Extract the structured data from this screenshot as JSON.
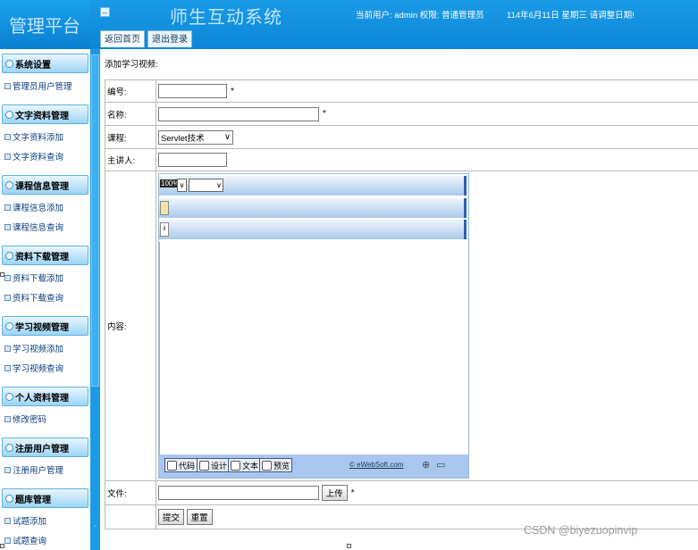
{
  "header": {
    "logo_text": "管理平台",
    "system_title": "师生互动系统",
    "user_info": "当前用户: admin 权限: 普通管理员",
    "date_info": "114年6月11日 星期三   请调整日期!",
    "toggle_icon": "◂▸",
    "tabs": [
      {
        "label": "返回首页"
      },
      {
        "label": "退出登录"
      }
    ]
  },
  "sidebar": {
    "groups": [
      {
        "title": "系统设置",
        "items": [
          "管理员用户管理"
        ]
      },
      {
        "title": "文字资料管理",
        "items": [
          "文字资料添加",
          "文字资料查询"
        ]
      },
      {
        "title": "课程信息管理",
        "items": [
          "课程信息添加",
          "课程信息查询"
        ]
      },
      {
        "title": "资料下载管理",
        "items": [
          "资料下载添加",
          "资料下载查询"
        ]
      },
      {
        "title": "学习视频管理",
        "items": [
          "学习视频添加",
          "学习视频查询"
        ]
      },
      {
        "title": "个人资料管理",
        "items": [
          "修改密码"
        ]
      },
      {
        "title": "注册用户管理",
        "items": [
          "注册用户管理"
        ]
      },
      {
        "title": "题库管理",
        "items": [
          "试题添加",
          "试题查询"
        ]
      }
    ]
  },
  "main": {
    "page_title": "添加学习视频:",
    "form": {
      "number_label": "编号:",
      "name_label": "名称:",
      "course_label": "课程:",
      "course_value": "Servlet技术",
      "speaker_label": "主讲人:",
      "content_label": "内容:",
      "file_label": "文件:",
      "upload_label": "上传",
      "required_mark": "*",
      "submit_label": "提交",
      "reset_label": "重置"
    },
    "editor": {
      "zoom_value": "100%",
      "mode_code": "代码",
      "mode_design": "设计",
      "mode_text": "文本",
      "mode_preview": "预览",
      "copyright": "© eWebSoft.com",
      "zoom_in": "⊕",
      "zoom_out": "▭"
    }
  },
  "watermark": "CSDN @biyezuopinvip",
  "colors": {
    "header_blue": "#0b86d8",
    "sidebar_blue": "#0d93e3",
    "editor_toolbar": "#a9c8ea"
  }
}
